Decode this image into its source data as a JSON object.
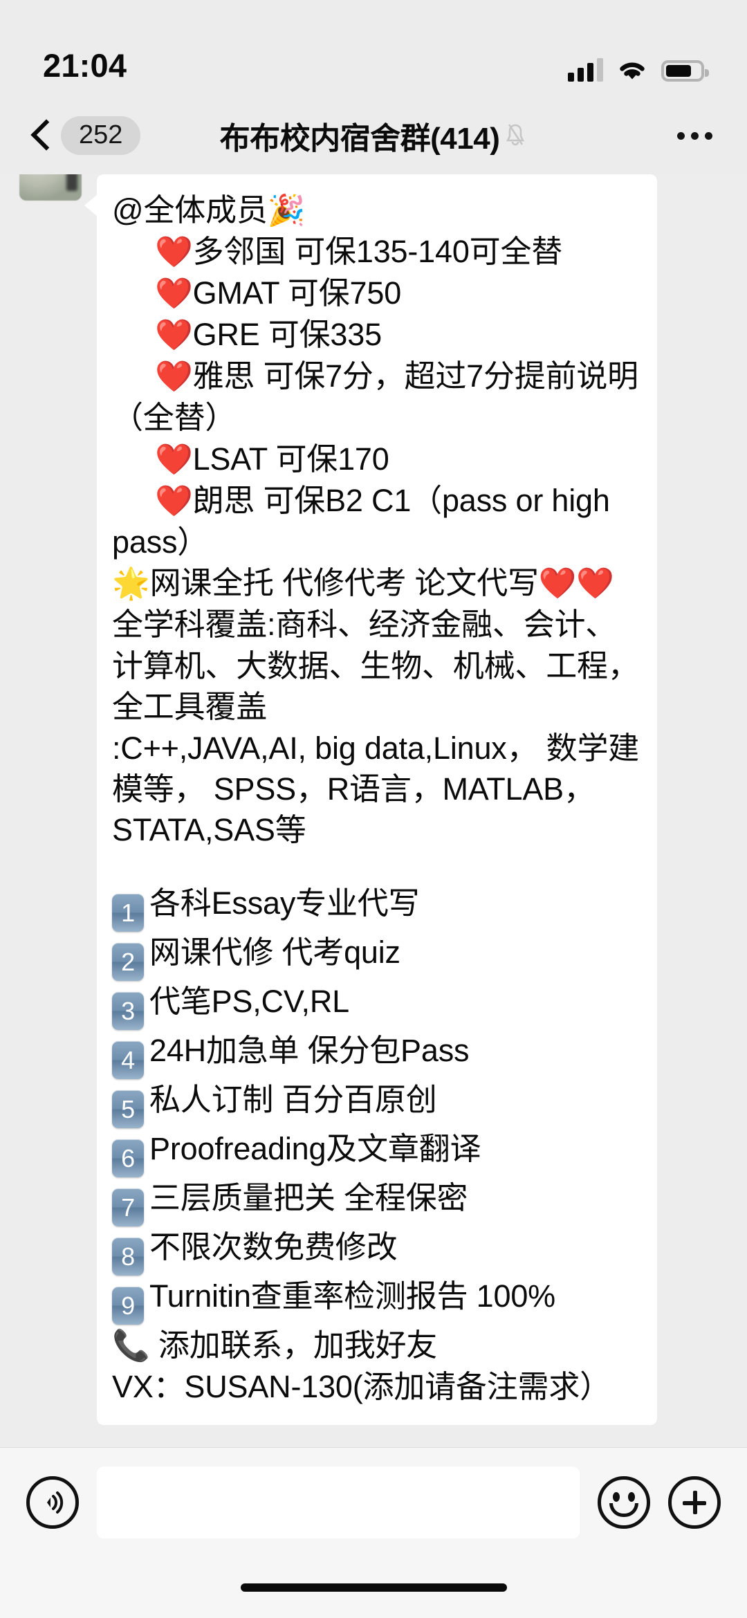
{
  "status_bar": {
    "time": "21:04",
    "signal_icon": "signal-bars-icon",
    "wifi_icon": "wifi-icon",
    "battery_icon": "battery-icon",
    "battery_level_pct": 74
  },
  "nav_bar": {
    "back_icon": "back-chevron-icon",
    "unread_count": "252",
    "title": "布布校内宿舍群(414)",
    "mute_icon": "bell-muted-icon",
    "more_icon": "more-options-icon"
  },
  "message": {
    "avatar_name": "sender-avatar",
    "lines": {
      "l1": "@全体成员",
      "l1_emoji": "🎉",
      "l2_emoji": "❤️",
      "l2": "多邻国  可保135-140可全替",
      "l3_emoji": "❤️",
      "l3": "GMAT  可保750",
      "l4_emoji": "❤️",
      "l4": "GRE      可保335",
      "l5_emoji": "❤️",
      "l5": "雅思      可保7分，超过7分提前说明（全替）",
      "l6_emoji": "❤️",
      "l6": "LSAT     可保170",
      "l7_emoji": "❤️",
      "l7": "朗思      可保B2 C1（pass or high pass）",
      "l8_emoji": "🌟",
      "l8": "网课全托 代修代考 论文代写",
      "l8_tail_emoji": "❤️❤️",
      "l9": "全学科覆盖:商科、经济金融、会计、计算机、大数据、生物、机械、工程，全工具覆盖",
      "l10": ":C++,JAVA,AI, big data,Linux， 数学建模等， SPSS，R语言，MATLAB， STATA,SAS等"
    },
    "numbered_items": [
      {
        "num": "1",
        "text": "各科Essay专业代写"
      },
      {
        "num": "2",
        "text": "网课代修 代考quiz"
      },
      {
        "num": "3",
        "text": "代笔PS,CV,RL"
      },
      {
        "num": "4",
        "text": "24H加急单 保分包Pass"
      },
      {
        "num": "5",
        "text": "私人订制 百分百原创"
      },
      {
        "num": "6",
        "text": "Proofreading及文章翻译"
      },
      {
        "num": "7",
        "text": "三层质量把关 全程保密"
      },
      {
        "num": "8",
        "text": "不限次数免费修改"
      },
      {
        "num": "9",
        "text": "Turnitin查重率检测报告 100%"
      }
    ],
    "contact": {
      "phone_emoji": "📞",
      "contact_line": "添加联系，加我好友",
      "vx_line": "VX：SUSAN-130(添加请备注需求）"
    }
  },
  "input_bar": {
    "voice_icon": "voice-input-icon",
    "input_value": "",
    "input_placeholder": "",
    "emoji_icon": "smiley-face-icon",
    "plus_icon": "plus-icon"
  },
  "colors": {
    "screen_bg": "#ededed",
    "bar_bg": "#ececec",
    "bubble_bg": "#ffffff",
    "badge_bg": "#d6d6d6",
    "keycap_blue": "#6f8fae",
    "text": "#0b0b0b"
  }
}
